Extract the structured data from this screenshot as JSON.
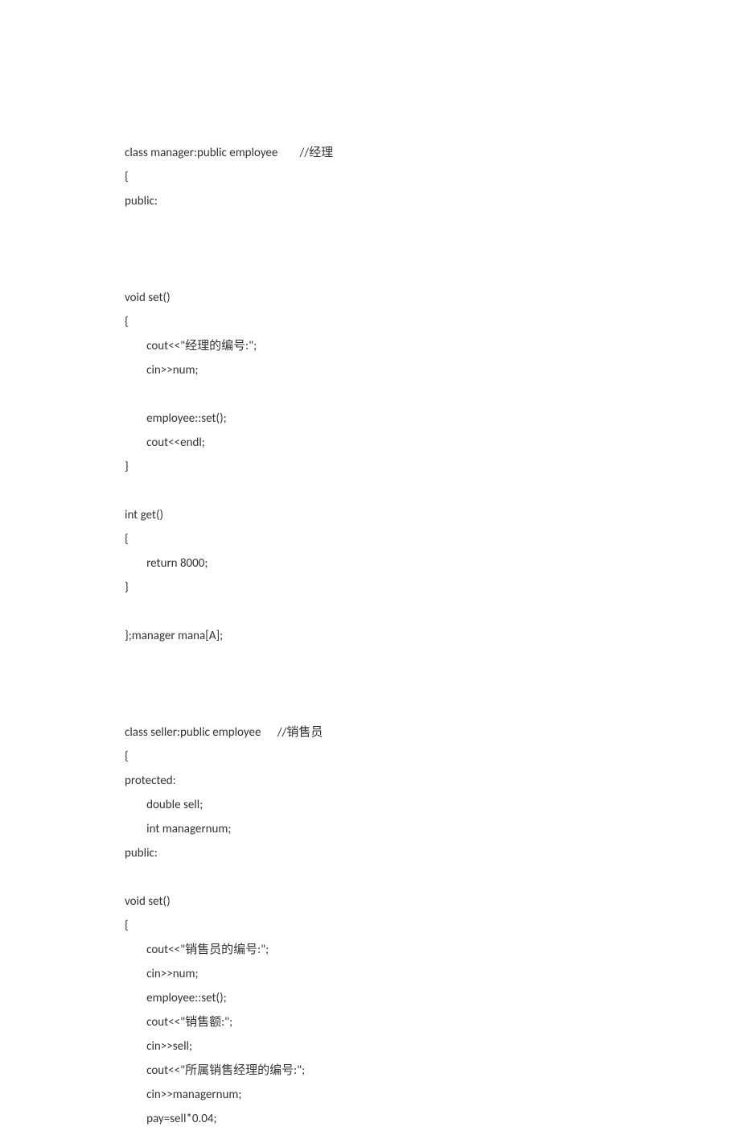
{
  "code": {
    "l1": "class manager:public employee        //经理",
    "l2": "{",
    "l3": "public:",
    "l4": "void set()",
    "l5": "{",
    "l6": "        cout<<\"经理的编号:\";",
    "l7": "        cin>>num;",
    "l8": "        employee::set();",
    "l9": "        cout<<endl;",
    "l10": "}",
    "l11": "int get()",
    "l12": "{",
    "l13": "        return 8000;",
    "l14": "}",
    "l15": "};manager mana[A];",
    "l16": "class seller:public employee      //销售员",
    "l17": "{",
    "l18": "protected:",
    "l19": "        double sell;",
    "l20": "        int managernum;",
    "l21": "public:",
    "l22": "void set()",
    "l23": "{",
    "l24": "        cout<<\"销售员的编号:\";",
    "l25": "        cin>>num;",
    "l26": "        employee::set();",
    "l27": "        cout<<\"销售额:\";",
    "l28": "        cin>>sell;",
    "l29": "        cout<<\"所属销售经理的编号:\";",
    "l30": "        cin>>managernum;",
    "l31": "        pay=sell*0.04;"
  }
}
